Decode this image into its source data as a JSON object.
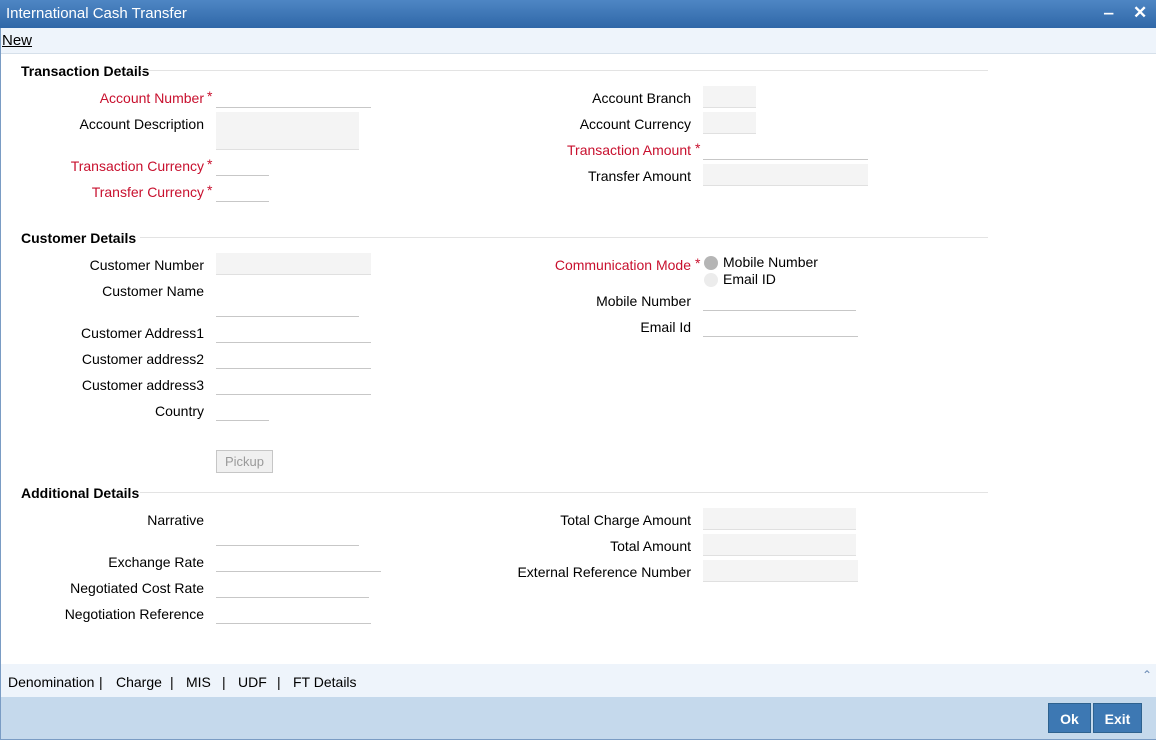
{
  "window": {
    "title": "International Cash Transfer",
    "minimize": "‒",
    "close": "✕"
  },
  "menu": {
    "new": "New"
  },
  "sections": {
    "transaction": "Transaction Details",
    "customer": "Customer Details",
    "additional": "Additional Details"
  },
  "transaction": {
    "account_number": "Account Number",
    "account_description": "Account Description",
    "transaction_currency": "Transaction Currency",
    "transfer_currency": "Transfer Currency",
    "account_branch": "Account Branch",
    "account_currency": "Account Currency",
    "transaction_amount": "Transaction Amount",
    "transfer_amount": "Transfer Amount"
  },
  "customer": {
    "customer_number": "Customer Number",
    "customer_name": "Customer Name",
    "address1": "Customer Address1",
    "address2": "Customer address2",
    "address3": "Customer address3",
    "country": "Country",
    "pickup": "Pickup",
    "communication_mode": "Communication Mode",
    "mode_options": [
      "Mobile Number",
      "Email ID"
    ],
    "mode_selected": "Mobile Number",
    "mobile_number": "Mobile Number",
    "email_id": "Email Id"
  },
  "additional": {
    "narrative": "Narrative",
    "exchange_rate": "Exchange Rate",
    "negotiated_cost_rate": "Negotiated Cost Rate",
    "negotiation_reference": "Negotiation Reference",
    "total_charge_amount": "Total Charge Amount",
    "total_amount": "Total Amount",
    "external_reference_number": "External Reference Number"
  },
  "required_marker": "*",
  "tabs": [
    "Denomination",
    "Charge",
    "MIS",
    "UDF",
    "FT Details"
  ],
  "tab_separator": "|",
  "footer": {
    "ok": "Ok",
    "exit": "Exit"
  }
}
